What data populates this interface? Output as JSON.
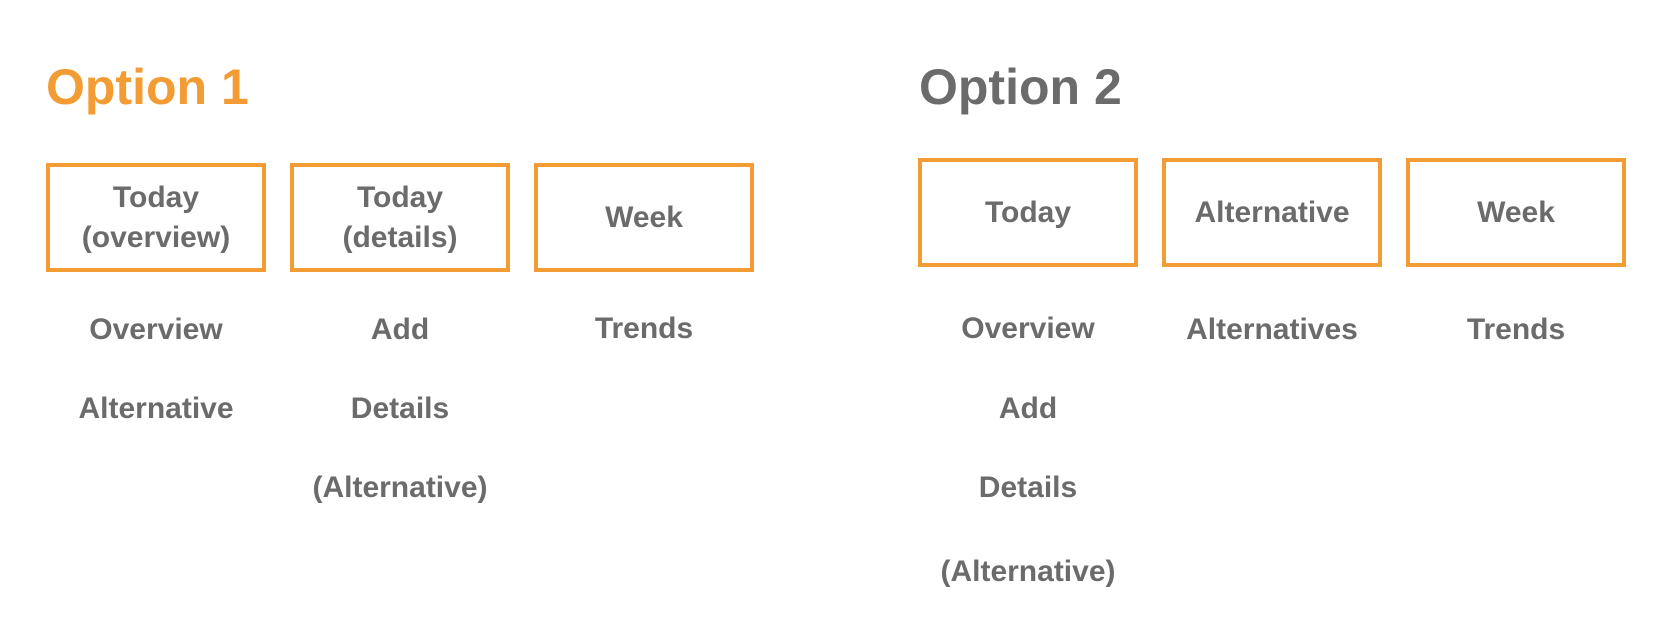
{
  "colors": {
    "accent": "#F39C34",
    "text": "#6B6B6B",
    "background": "#FFFFFF"
  },
  "options": [
    {
      "title": "Option 1",
      "title_color": "#F39C34",
      "tabs": [
        {
          "label": "Today\n(overview)",
          "items": [
            "Overview",
            "Alternative"
          ]
        },
        {
          "label": "Today\n(details)",
          "items": [
            "Add",
            "Details",
            "(Alternative)"
          ]
        },
        {
          "label": "Week",
          "items": [
            "Trends"
          ]
        }
      ]
    },
    {
      "title": "Option 2",
      "title_color": "#6B6B6B",
      "tabs": [
        {
          "label": "Today",
          "items": [
            "Overview",
            "Add",
            "Details",
            "(Alternative)"
          ]
        },
        {
          "label": "Alternative",
          "items": [
            "Alternatives"
          ]
        },
        {
          "label": "Week",
          "items": [
            "Trends"
          ]
        }
      ]
    }
  ]
}
